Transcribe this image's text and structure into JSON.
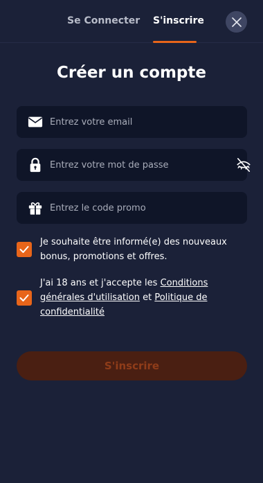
{
  "tabs": {
    "login": "Se Connecter",
    "register": "S'inscrire",
    "active": "register"
  },
  "close_icon": "close-icon",
  "title": "Créer un compte",
  "fields": {
    "email": {
      "placeholder": "Entrez votre email",
      "icon": "mail-icon",
      "value": ""
    },
    "password": {
      "placeholder": "Entrez votre mot de passe",
      "icon": "lock-icon",
      "toggle_icon": "eye-off-icon",
      "value": ""
    },
    "promo": {
      "placeholder": "Entrez le code promo",
      "icon": "gift-icon",
      "value": ""
    }
  },
  "checkboxes": {
    "newsletter": {
      "checked": true,
      "text": "Je souhaite être informé(e) des nouveaux bonus, promotions et offres."
    },
    "terms": {
      "checked": true,
      "text_before": "J'ai 18 ans et j'accepte les ",
      "link_terms": "Conditions générales d'utilisation",
      "text_mid": " et ",
      "link_privacy": "Politique de confidentialité"
    }
  },
  "submit_label": "S'inscrire",
  "colors": {
    "background": "#1b2138",
    "field": "#0f1528",
    "accent": "#e8651a",
    "submit_disabled_bg": "#4a1f12",
    "submit_disabled_text": "#8f3c19"
  }
}
